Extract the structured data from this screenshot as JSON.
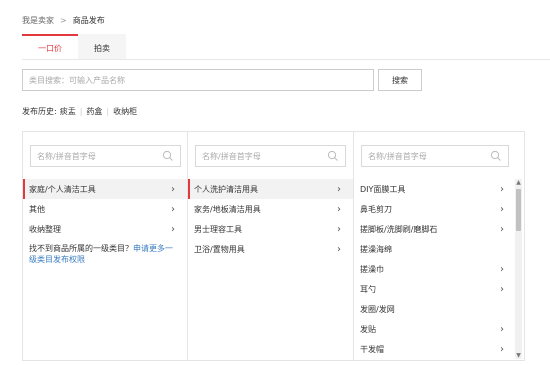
{
  "breadcrumb": {
    "first": "我是卖家",
    "separator": ">",
    "current": "商品发布"
  },
  "tabs": [
    {
      "label": "一口价",
      "active": true
    },
    {
      "label": "拍卖",
      "active": false
    }
  ],
  "search": {
    "placeholder": "类目搜索：可输入产品名称",
    "value": "",
    "button_label": "搜索"
  },
  "history": {
    "label": "发布历史:",
    "items": [
      "痰盂",
      "药盒",
      "收纳柜"
    ]
  },
  "panel_search_placeholder": "名称/拼音首字母",
  "column1": {
    "items": [
      {
        "label": "家庭/个人清洁工具",
        "selected": true,
        "has_children": true
      },
      {
        "label": "其他",
        "selected": false,
        "has_children": true
      },
      {
        "label": "收纳整理",
        "selected": false,
        "has_children": true
      }
    ],
    "notfound_text": "找不到商品所属的一级类目？",
    "notfound_link": "申请更多一级类目发布权限"
  },
  "column2": {
    "items": [
      {
        "label": "个人洗护清洁用具",
        "selected": true,
        "has_children": true
      },
      {
        "label": "家务/地板清洁用具",
        "selected": false,
        "has_children": true
      },
      {
        "label": "男士理容工具",
        "selected": false,
        "has_children": true
      },
      {
        "label": "卫浴/置物用具",
        "selected": false,
        "has_children": true
      }
    ]
  },
  "column3": {
    "items": [
      {
        "label": "DIY面膜工具",
        "has_children": true
      },
      {
        "label": "鼻毛剪刀",
        "has_children": true
      },
      {
        "label": "搓脚板/洗脚刷/磨脚石",
        "has_children": true
      },
      {
        "label": "搓澡海绵",
        "has_children": false
      },
      {
        "label": "搓澡巾",
        "has_children": true
      },
      {
        "label": "耳勺",
        "has_children": true
      },
      {
        "label": "发圈/发网",
        "has_children": false
      },
      {
        "label": "发贴",
        "has_children": true
      },
      {
        "label": "干发帽",
        "has_children": true
      }
    ]
  },
  "colors": {
    "accent": "#e4393c",
    "link": "#3a7cc2"
  }
}
